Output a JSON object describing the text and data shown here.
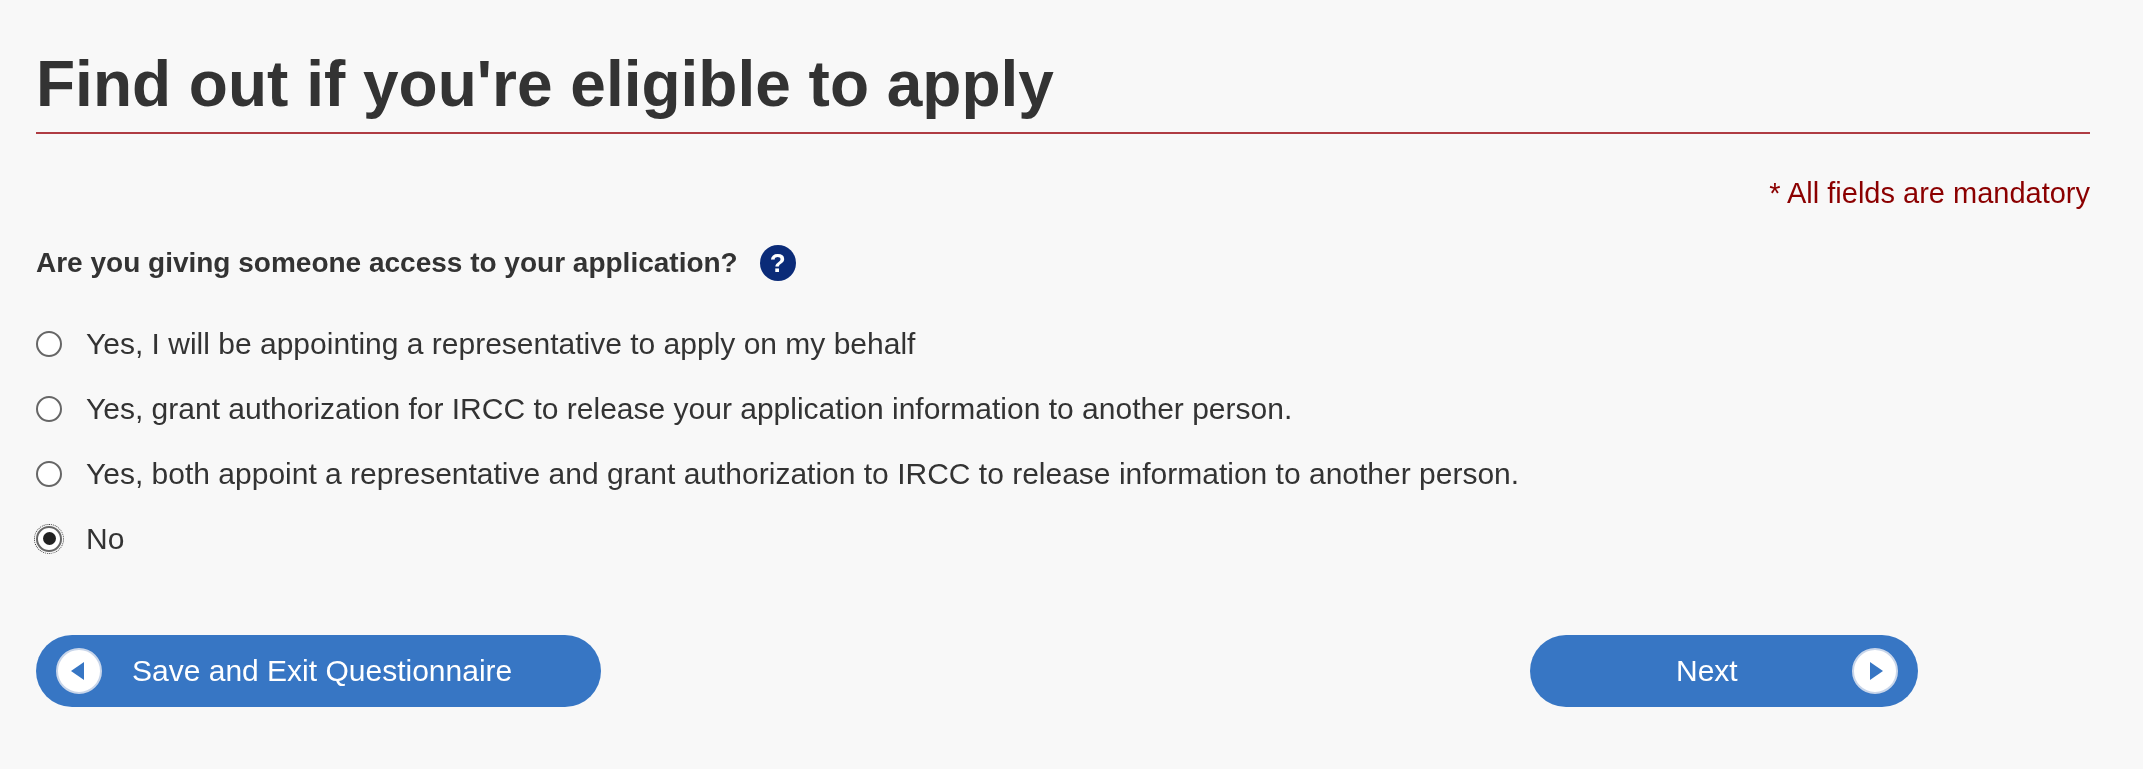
{
  "title": "Find out if you're eligible to apply",
  "mandatory_note": "* All fields are mandatory",
  "question": {
    "label": "Are you giving someone access to your application?",
    "help": "?"
  },
  "options": [
    {
      "label": "Yes, I will be appointing a representative to apply on my behalf",
      "selected": false
    },
    {
      "label": "Yes, grant authorization for IRCC to release your application information to another person.",
      "selected": false
    },
    {
      "label": "Yes, both appoint a representative and grant authorization to IRCC to release information to another person.",
      "selected": false
    },
    {
      "label": "No",
      "selected": true
    }
  ],
  "buttons": [
    {
      "label": "Save and Exit Questionnaire",
      "kind": "back"
    },
    {
      "label": "Next",
      "kind": "forward"
    }
  ]
}
